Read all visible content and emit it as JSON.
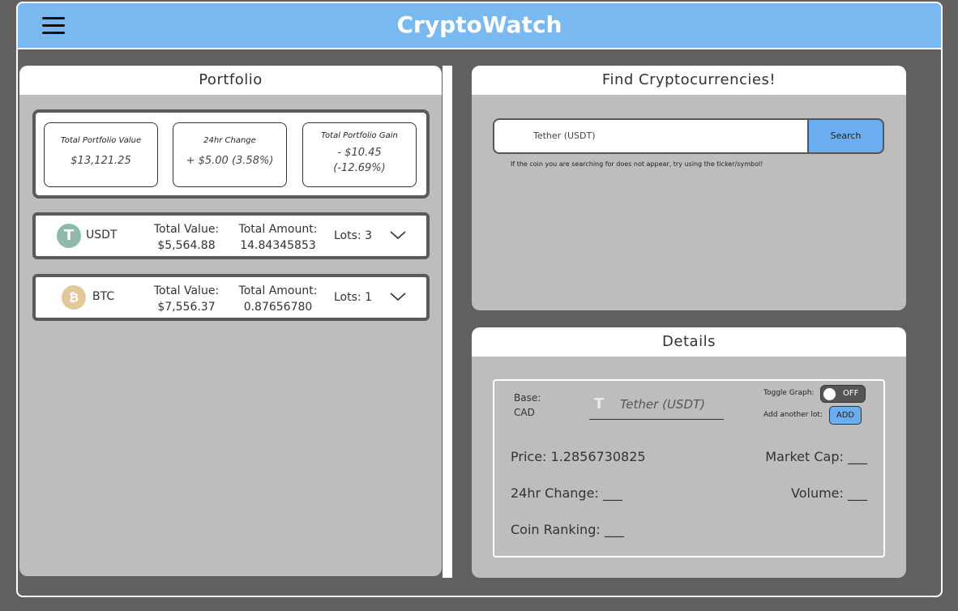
{
  "header": {
    "title": "CryptoWatch"
  },
  "portfolio": {
    "title": "Portfolio",
    "summary": {
      "total_value_label": "Total Portfolio Value",
      "total_value": "$13,121.25",
      "change_label": "24hr Change",
      "change_value": "+ $5.00 (3.58%)",
      "gain_label": "Total Portfolio Gain",
      "gain_value_line1": "- $10.45",
      "gain_value_line2": "(-12.69%)"
    },
    "coins": [
      {
        "symbol": "USDT",
        "logo_glyph": "T",
        "value_label": "Total Value:",
        "value": "$5,564.88",
        "amount_label": "Total Amount:",
        "amount": "14.84345853",
        "lots": "Lots: 3"
      },
      {
        "symbol": "BTC",
        "logo_glyph": "₿",
        "value_label": "Total Value:",
        "value": "$7,556.37",
        "amount_label": "Total Amount:",
        "amount": "0.87656780",
        "lots": "Lots: 1"
      }
    ]
  },
  "find": {
    "title": "Find Cryptocurrencies!",
    "search_value": "Tether (USDT)",
    "search_button": "Search",
    "hint": "If the coin you are searching for does not appear, try using the ticker/symbol!"
  },
  "details": {
    "title": "Details",
    "base_line1": "Base:",
    "base_line2": "CAD",
    "coin_glyph": "T",
    "coin_name": "Tether (USDT)",
    "toggle_label": "Toggle Graph:",
    "toggle_state": "OFF",
    "lot_label": "Add another lot:",
    "add_button": "ADD",
    "price": "Price: 1.2856730825",
    "market_cap": "Market Cap: ___",
    "change": "24hr Change: ___",
    "volume": "Volume: ___",
    "ranking": "Coin Ranking: ___"
  }
}
